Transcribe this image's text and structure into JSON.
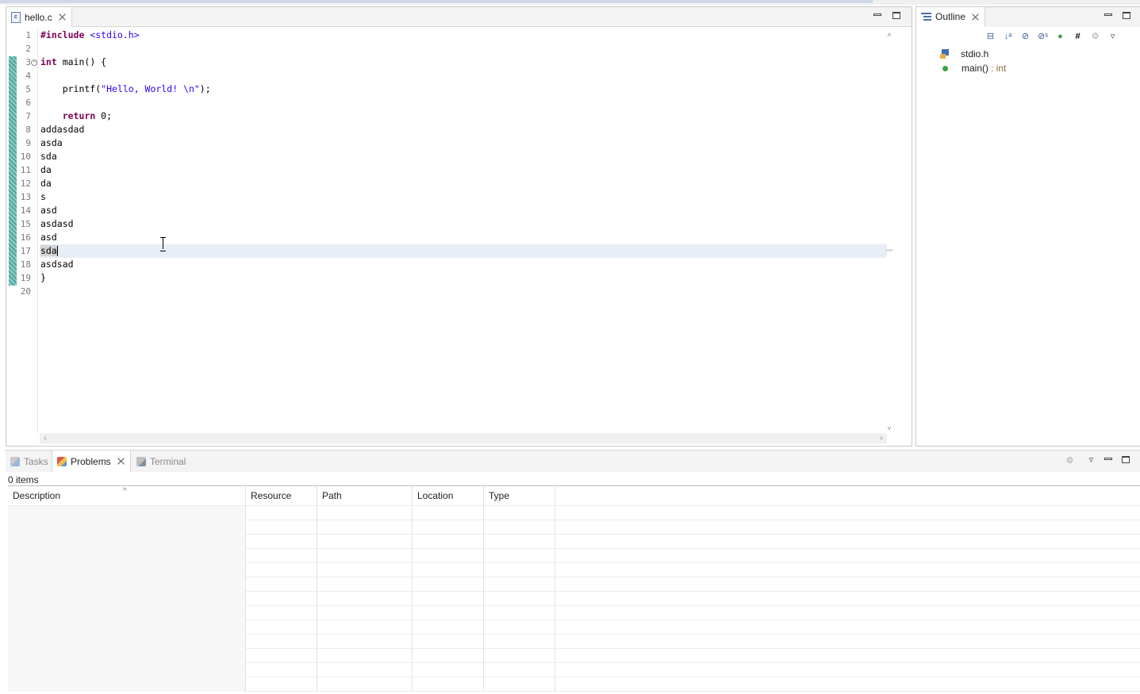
{
  "editor": {
    "tab_label": "hello.c",
    "file_icon_glyph": "c",
    "line_numbers": [
      "1",
      "2",
      "3",
      "4",
      "5",
      "6",
      "7",
      "8",
      "9",
      "10",
      "11",
      "12",
      "13",
      "14",
      "15",
      "16",
      "17",
      "18",
      "19",
      "20"
    ],
    "code": {
      "l1_directive": "#include",
      "l1_header": " <stdio.h>",
      "l3_kw": "int",
      "l3_rest": " main() {",
      "l5_indent": "    printf(",
      "l5_str": "\"Hello, World! \\n\"",
      "l5_end": ");",
      "l7_kw": "return",
      "l7_rest": " 0;",
      "l8": "addasdad",
      "l9": "asda",
      "l10": "sda",
      "l11": "da",
      "l12": "da",
      "l13": "s",
      "l14": "asd",
      "l15": "asdasd",
      "l16": "asd",
      "l17": "sda",
      "l18": "asdsad",
      "l19": "}"
    },
    "current_line": 17
  },
  "outline": {
    "tab_label": "Outline",
    "items": [
      {
        "name": "stdio.h",
        "type": ""
      },
      {
        "name": "main()",
        "type": ": int"
      }
    ]
  },
  "bottom": {
    "tabs": [
      {
        "label": "Tasks",
        "active": false
      },
      {
        "label": "Problems",
        "active": true
      },
      {
        "label": "Terminal",
        "active": false
      }
    ],
    "items_count": "0 items",
    "columns": [
      "Description",
      "Resource",
      "Path",
      "Location",
      "Type"
    ],
    "sort_indicator": "^"
  },
  "colors": {
    "keyword": "#7f0055",
    "string": "#2a00ff",
    "current_line": "#e8eef7",
    "change_marker": "#4fa3a0"
  }
}
